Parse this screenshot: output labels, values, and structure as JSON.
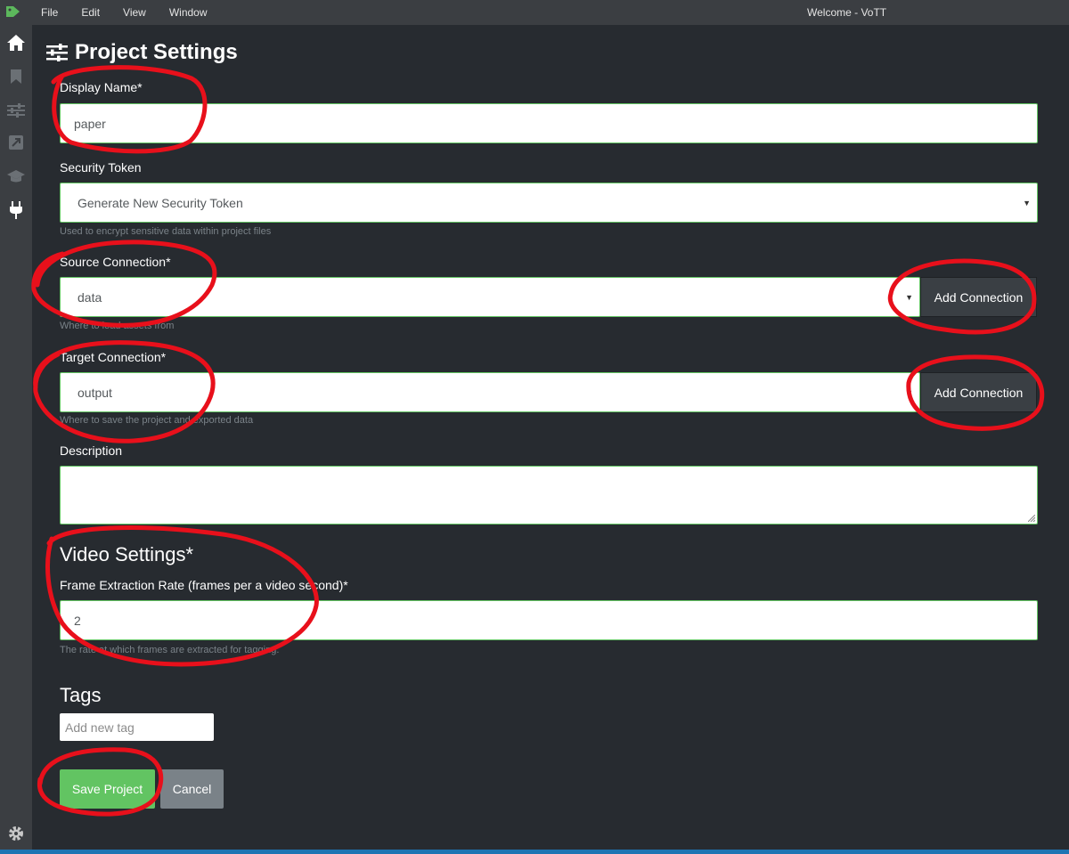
{
  "titlebar": {
    "menu": [
      "File",
      "Edit",
      "View",
      "Window"
    ],
    "window_title": "Welcome - VoTT"
  },
  "sidebar": {
    "items": [
      {
        "icon": "home-icon",
        "active": true
      },
      {
        "icon": "bookmark-icon",
        "active": false
      },
      {
        "icon": "sliders-icon",
        "active": false
      },
      {
        "icon": "export-icon",
        "active": false
      },
      {
        "icon": "graduation-cap-icon",
        "active": false
      },
      {
        "icon": "plug-icon",
        "active": false
      }
    ],
    "bottom_icon": "gear-icon"
  },
  "page": {
    "title": "Project Settings",
    "title_icon": "sliders-icon"
  },
  "form": {
    "display_name": {
      "label": "Display Name*",
      "value": "paper"
    },
    "security_token": {
      "label": "Security Token",
      "value": "Generate New Security Token",
      "help": "Used to encrypt sensitive data within project files"
    },
    "source_connection": {
      "label": "Source Connection*",
      "value": "data",
      "help": "Where to load assets from",
      "button": "Add Connection"
    },
    "target_connection": {
      "label": "Target Connection*",
      "value": "output",
      "help": "Where to save the project and exported data",
      "button": "Add Connection"
    },
    "description": {
      "label": "Description",
      "value": ""
    }
  },
  "video_settings": {
    "heading": "Video Settings*",
    "frame_rate": {
      "label": "Frame Extraction Rate (frames per a video second)*",
      "value": "2",
      "help": "The rate at which frames are extracted for tagging."
    }
  },
  "tags": {
    "heading": "Tags",
    "placeholder": "Add new tag"
  },
  "actions": {
    "save": "Save Project",
    "cancel": "Cancel"
  },
  "colors": {
    "background": "#272b30",
    "sidebar": "#3b3e42",
    "success": "#62c462",
    "annotation": "#e8101b"
  }
}
